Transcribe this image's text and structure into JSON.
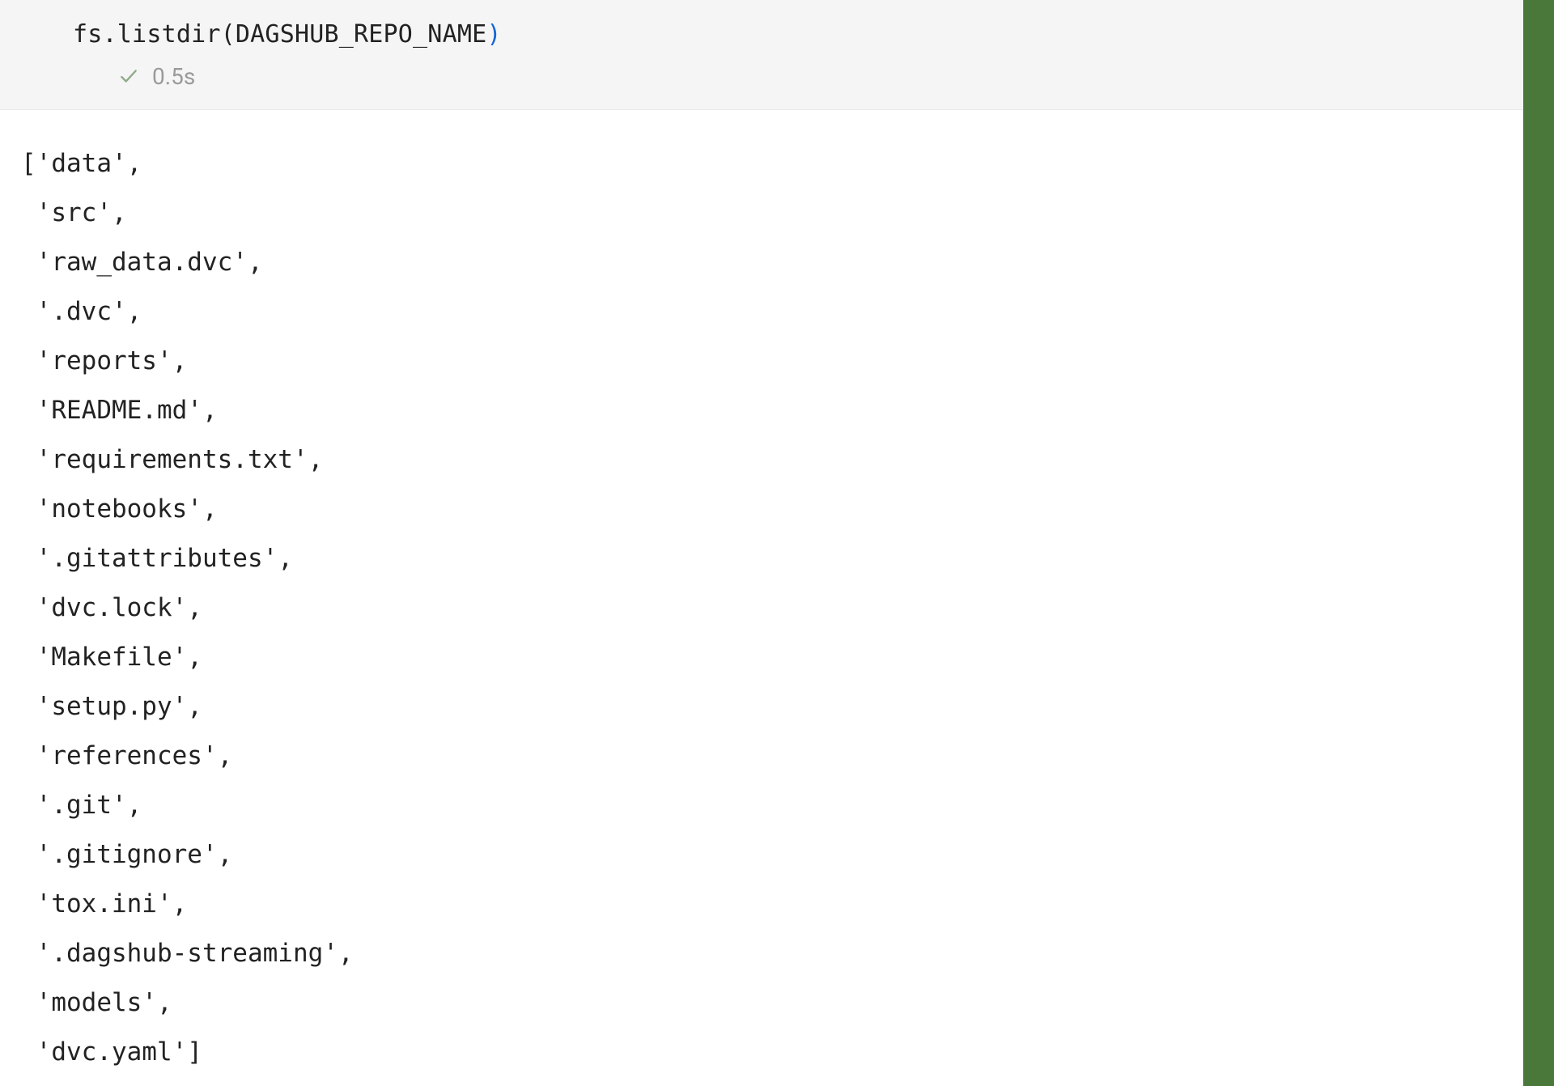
{
  "input": {
    "indent": "    ",
    "obj": "fs",
    "dot": ".",
    "method": "listdir",
    "paren_open": "(",
    "arg": "DAGSHUB_REPO_NAME",
    "paren_close": ")"
  },
  "status": {
    "duration": "0.5s"
  },
  "output": {
    "items": [
      "data",
      "src",
      "raw_data.dvc",
      ".dvc",
      "reports",
      "README.md",
      "requirements.txt",
      "notebooks",
      ".gitattributes",
      "dvc.lock",
      "Makefile",
      "setup.py",
      "references",
      ".git",
      ".gitignore",
      "tox.ini",
      ".dagshub-streaming",
      "models",
      "dvc.yaml"
    ]
  },
  "colors": {
    "accent_right_bar": "#4a773a",
    "paren_close_color": "#1566d6",
    "input_bg": "#f5f5f5",
    "status_text": "#9a9a9a"
  }
}
